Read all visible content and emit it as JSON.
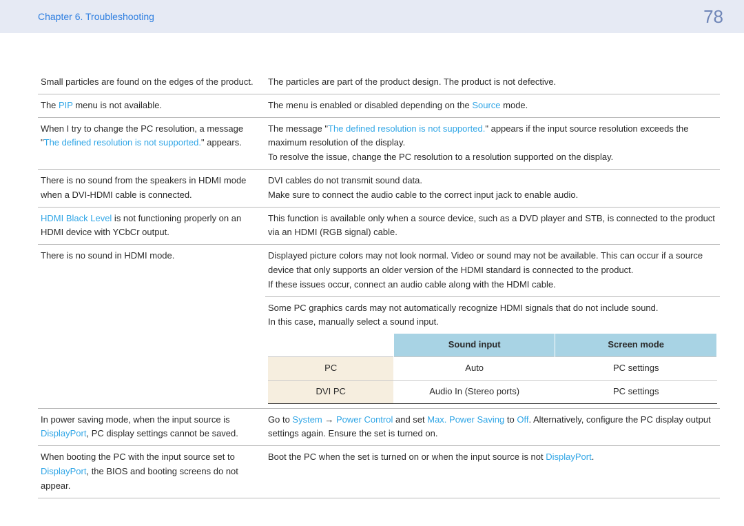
{
  "header": {
    "chapter": "Chapter 6. Troubleshooting",
    "page": "78"
  },
  "rows": {
    "r1": {
      "issue": "Small particles are found on the edges of the product.",
      "sol": "The particles are part of the product design. The product is not defective."
    },
    "r2": {
      "issue_a": "The ",
      "issue_link": "PIP",
      "issue_b": " menu is not available.",
      "sol_a": "The menu is enabled or disabled depending on the ",
      "sol_link": "Source",
      "sol_b": " mode."
    },
    "r3": {
      "issue_a": "When I try to change the PC resolution, a message \"",
      "issue_link": "The defined resolution is not supported.",
      "issue_b": "\" appears.",
      "sol_a": "The message \"",
      "sol_link": "The defined resolution is not supported.",
      "sol_b": "\" appears if the input source resolution exceeds the maximum resolution of the display.",
      "sol_c": "To resolve the issue, change the PC resolution to a resolution supported on the display."
    },
    "r4": {
      "issue": "There is no sound from the speakers in HDMI mode when a DVI-HDMI cable is connected.",
      "sol_a": "DVI cables do not transmit sound data.",
      "sol_b": "Make sure to connect the audio cable to the correct input jack to enable audio."
    },
    "r5": {
      "issue_link": "HDMI Black Level",
      "issue_b": " is not functioning properly on an HDMI device with YCbCr output.",
      "sol": "This function is available only when a source device, such as a DVD player and STB, is connected to the product via an HDMI (RGB signal) cable."
    },
    "r6": {
      "issue": "There is no sound in HDMI mode.",
      "sol_a": "Displayed picture colors may not look normal. Video or sound may not be available. This can occur if a source device that only supports an older version of the HDMI standard is connected to the product.",
      "sol_b": "If these issues occur, connect an audio cable along with the HDMI cable.",
      "sol_c": "Some PC graphics cards may not automatically recognize HDMI signals that do not include sound.",
      "sol_d": "In this case, manually select a sound input.",
      "table": {
        "h1": "",
        "h2": "Sound input",
        "h3": "Screen mode",
        "row1": {
          "c1": "PC",
          "c2": "Auto",
          "c3": "PC settings"
        },
        "row2": {
          "c1": "DVI PC",
          "c2": "Audio In (Stereo ports)",
          "c3": "PC settings"
        }
      }
    },
    "r7": {
      "issue_a": "In power saving mode, when the input source is ",
      "issue_link": "DisplayPort",
      "issue_b": ", PC display settings cannot be saved.",
      "sol_a": "Go to ",
      "sol_l1": "System",
      "sol_arrow": " → ",
      "sol_l2": "Power Control",
      "sol_mid": " and set ",
      "sol_l3": "Max. Power Saving",
      "sol_to": " to ",
      "sol_l4": "Off",
      "sol_b": ". Alternatively, configure the PC display output settings again. Ensure the set is turned on."
    },
    "r8": {
      "issue_a": "When booting the PC with the input source set to ",
      "issue_link": "DisplayPort",
      "issue_b": ", the BIOS and booting screens do not appear.",
      "sol_a": "Boot the PC when the set is turned on or when the input source is not ",
      "sol_link": "DisplayPort",
      "sol_b": "."
    }
  }
}
